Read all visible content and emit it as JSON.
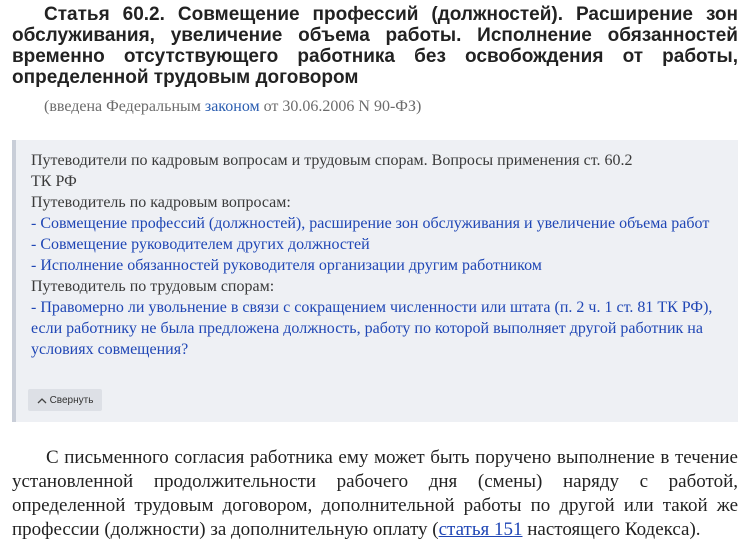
{
  "article": {
    "title_lines": [
      "Статья 60.2. Совмещение профессий (должностей). Расширение зон",
      "обслуживания, увеличение объема работы. Исполнение обязанностей",
      "временно отсутствующего работника без освобождения от работы,",
      "определенной трудовым договором"
    ],
    "note_before": "(введена Федеральным ",
    "note_link": "законом",
    "note_after": " от 30.06.2006 N 90-ФЗ)"
  },
  "guide": {
    "header_lines": [
      "Путеводители по кадровым вопросам и трудовым спорам. Вопросы применения ст. 60.2",
      "ТК РФ"
    ],
    "section1_title": "Путеводитель по кадровым вопросам:",
    "section1_links": [
      "- Совмещение профессий (должностей), расширение зон обслуживания и увеличение объема работ",
      "- Совмещение руководителем других должностей",
      "- Исполнение обязанностей руководителя организации другим работником"
    ],
    "section2_title": "Путеводитель по трудовым спорам:",
    "section2_links": [
      "- Правомерно ли увольнение в связи с сокращением численности или штата (п. 2 ч. 1 ст. 81 ТК РФ), если работнику не была предложена должность, работу по которой выполняет другой работник на условиях совмещения?"
    ],
    "collapse_label": "Свернуть"
  },
  "body": {
    "lines": [
      "С письменного согласия работника ему может быть поручено выполнение в течение",
      "установленной продолжительности рабочего дня (смены) наряду с работой,",
      "определенной трудовым договором, дополнительной работы по другой или такой же",
      "профессии (должности) за дополнительную оплату ("
    ],
    "link": "статья 151",
    "tail": " настоящего Кодекса)."
  }
}
